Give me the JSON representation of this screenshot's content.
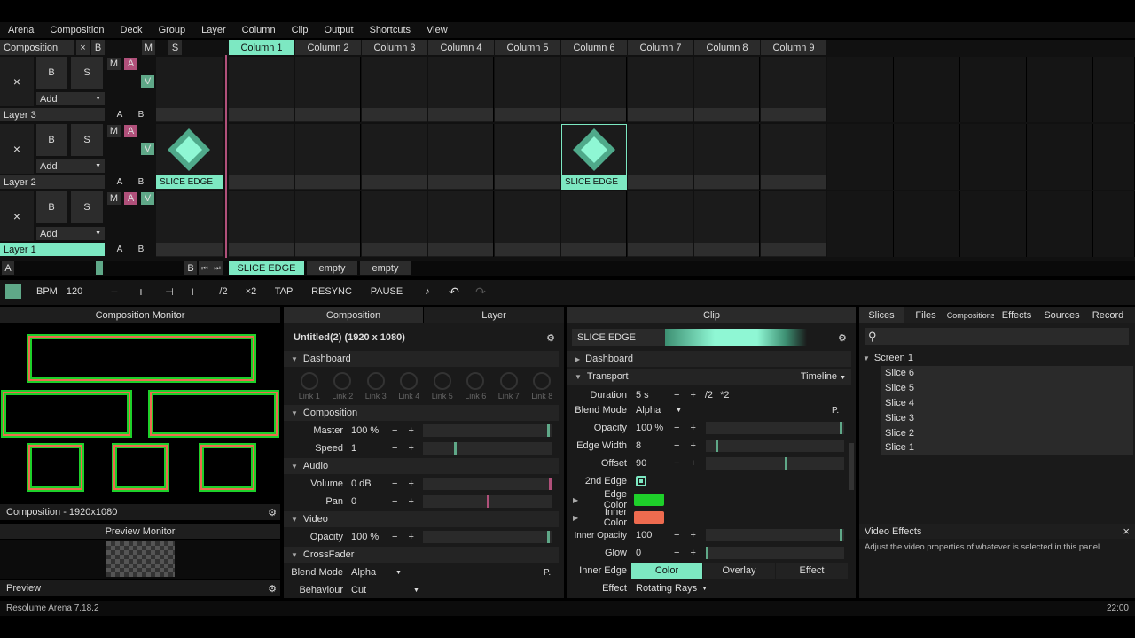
{
  "menu": [
    "Arena",
    "Composition",
    "Deck",
    "Group",
    "Layer",
    "Column",
    "Clip",
    "Output",
    "Shortcuts",
    "View"
  ],
  "header": {
    "composition": "Composition",
    "x": "×",
    "b": "B",
    "m": "M",
    "s": "S"
  },
  "columns": [
    "Column 1",
    "Column 2",
    "Column 3",
    "Column 4",
    "Column 5",
    "Column 6",
    "Column 7",
    "Column 8",
    "Column 9"
  ],
  "layers": [
    {
      "name": "Layer 3",
      "add": "Add",
      "b": "B",
      "s": "S",
      "m": "M",
      "a": "A",
      "v": "V",
      "ab_a": "A",
      "ab_b": "B",
      "x": "×"
    },
    {
      "name": "Layer 2",
      "add": "Add",
      "b": "B",
      "s": "S",
      "m": "M",
      "a": "A",
      "v": "V",
      "ab_a": "A",
      "ab_b": "B",
      "x": "×"
    },
    {
      "name": "Layer 1",
      "add": "Add",
      "b": "B",
      "s": "S",
      "m": "M",
      "a": "A",
      "v": "V",
      "ab_a": "A",
      "ab_b": "B",
      "x": "×"
    }
  ],
  "clips": {
    "l2c1": "SLICE EDGE",
    "l2c6": "SLICE EDGE"
  },
  "deck": {
    "a": "A",
    "b": "B",
    "tabs": [
      "SLICE EDGE",
      "empty",
      "empty"
    ]
  },
  "transport": {
    "bpm_label": "BPM",
    "bpm": "120",
    "minus": "−",
    "plus": "+",
    "div": "/2",
    "mul": "×2",
    "tap": "TAP",
    "resync": "RESYNC",
    "pause": "PAUSE"
  },
  "compMonitor": {
    "title": "Composition Monitor",
    "footer": "Composition - 1920x1080"
  },
  "previewMonitor": {
    "title": "Preview Monitor",
    "footer": "Preview"
  },
  "midTabs": [
    "Composition",
    "Layer"
  ],
  "compPanel": {
    "title": "Untitled(2) (1920 x 1080)",
    "dashboard": "Dashboard",
    "links": [
      "Link 1",
      "Link 2",
      "Link 3",
      "Link 4",
      "Link 5",
      "Link 6",
      "Link 7",
      "Link 8"
    ],
    "composition": "Composition",
    "master_label": "Master",
    "master": "100 %",
    "speed_label": "Speed",
    "speed": "1",
    "audio": "Audio",
    "volume_label": "Volume",
    "volume": "0 dB",
    "pan_label": "Pan",
    "pan": "0",
    "video": "Video",
    "opacity_label": "Opacity",
    "opacity": "100 %",
    "crossfader": "CrossFader",
    "blend_label": "Blend Mode",
    "blend": "Alpha",
    "p": "P.",
    "behaviour_label": "Behaviour",
    "behaviour": "Cut",
    "master_level": 0.97,
    "speed_level": 0.25,
    "volume_level": 0.98,
    "pan_level": 0.5,
    "opacity_level": 0.97
  },
  "clipPanel": {
    "tab": "Clip",
    "name": "SLICE EDGE",
    "dashboard": "Dashboard",
    "transport": "Transport",
    "timeline": "Timeline",
    "duration_label": "Duration",
    "duration": "5 s",
    "div": "/2",
    "mul": "*2",
    "blend_label": "Blend Mode",
    "blend": "Alpha",
    "p": "P.",
    "opacity_label": "Opacity",
    "opacity": "100 %",
    "edgewidth_label": "Edge Width",
    "edgewidth": "8",
    "offset_label": "Offset",
    "offset": "90",
    "secondedge_label": "2nd Edge",
    "edgecolor_label": "Edge Color",
    "innercolor_label": "Inner Color",
    "inneropacity_label": "Inner Opacity",
    "inneropacity": "100",
    "glow_label": "Glow",
    "glow": "0",
    "inneredge_label": "Inner Edge",
    "inneredge_opts": [
      "Color",
      "Overlay",
      "Effect"
    ],
    "effect_label": "Effect",
    "effect": "Rotating Rays",
    "edge_color": "#1ed02a",
    "inner_color": "#ee6b4f",
    "opacity_level": 0.98,
    "edgewidth_level": 0.08,
    "offset_level": 0.58,
    "inneropacity_level": 0.98,
    "glow_level": 0.0
  },
  "rightTabs": [
    "Slices",
    "Files",
    "Compositions",
    "Effects",
    "Sources",
    "Record"
  ],
  "slices": {
    "screen": "Screen 1",
    "items": [
      "Slice 6",
      "Slice 5",
      "Slice 4",
      "Slice 3",
      "Slice 2",
      "Slice 1"
    ]
  },
  "videoEffects": {
    "title": "Video Effects",
    "close": "×",
    "desc": "Adjust the video properties of whatever is selected in this panel."
  },
  "status": {
    "version": "Resolume Arena 7.18.2",
    "time": "22:00"
  },
  "colors": {
    "accent": "#7de8c2",
    "pink": "#b0507a",
    "teal": "#5fa888"
  }
}
